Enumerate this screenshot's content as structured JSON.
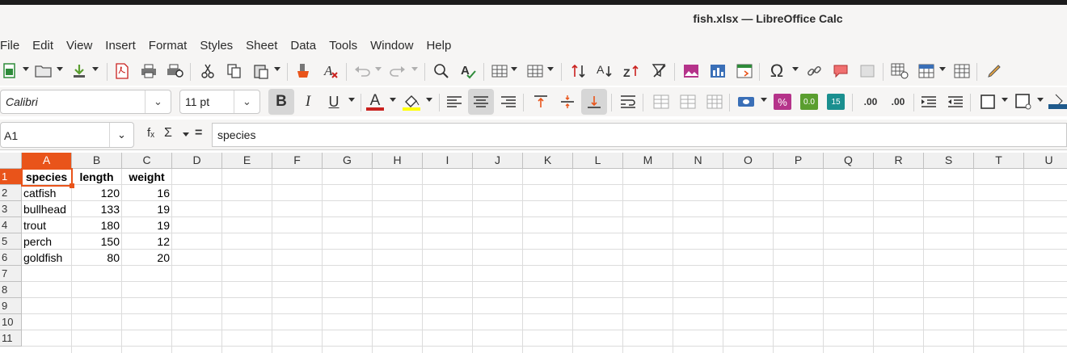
{
  "window": {
    "title": "fish.xlsx — LibreOffice Calc"
  },
  "menu": [
    "File",
    "Edit",
    "View",
    "Insert",
    "Format",
    "Styles",
    "Sheet",
    "Data",
    "Tools",
    "Window",
    "Help"
  ],
  "format_bar": {
    "font_name": "Calibri",
    "font_size": "11 pt",
    "bold_label": "B",
    "italic_label": "I",
    "underline_label": "U",
    "font_color_label": "A",
    "font_color": "#c9211e",
    "highlight_color": "#ffff00",
    "number_format_percent": "%",
    "number_format_general": "0.0",
    "number_format_scientific": "15",
    "add_decimal": ".00",
    "delete_decimal": ".00"
  },
  "formula_bar": {
    "cell_ref": "A1",
    "fx_label": "fₓ",
    "sum_label": "Σ",
    "equals_label": "=",
    "content": "species"
  },
  "sheet": {
    "columns": [
      "A",
      "B",
      "C",
      "D",
      "E",
      "F",
      "G",
      "H",
      "I",
      "J",
      "K",
      "L",
      "M",
      "N",
      "O",
      "P",
      "Q",
      "R",
      "S",
      "T",
      "U"
    ],
    "rows": [
      "1",
      "2",
      "3",
      "4",
      "5",
      "6",
      "7",
      "8",
      "9",
      "10",
      "11"
    ],
    "selected_cell": "A1",
    "accent_color": "#e9541a",
    "header_row": [
      "species",
      "length",
      "weight"
    ],
    "data_rows": [
      [
        "catfish",
        "120",
        "16"
      ],
      [
        "bullhead",
        "133",
        "19"
      ],
      [
        "trout",
        "180",
        "19"
      ],
      [
        "perch",
        "150",
        "12"
      ],
      [
        "goldfish",
        "80",
        "20"
      ]
    ]
  }
}
